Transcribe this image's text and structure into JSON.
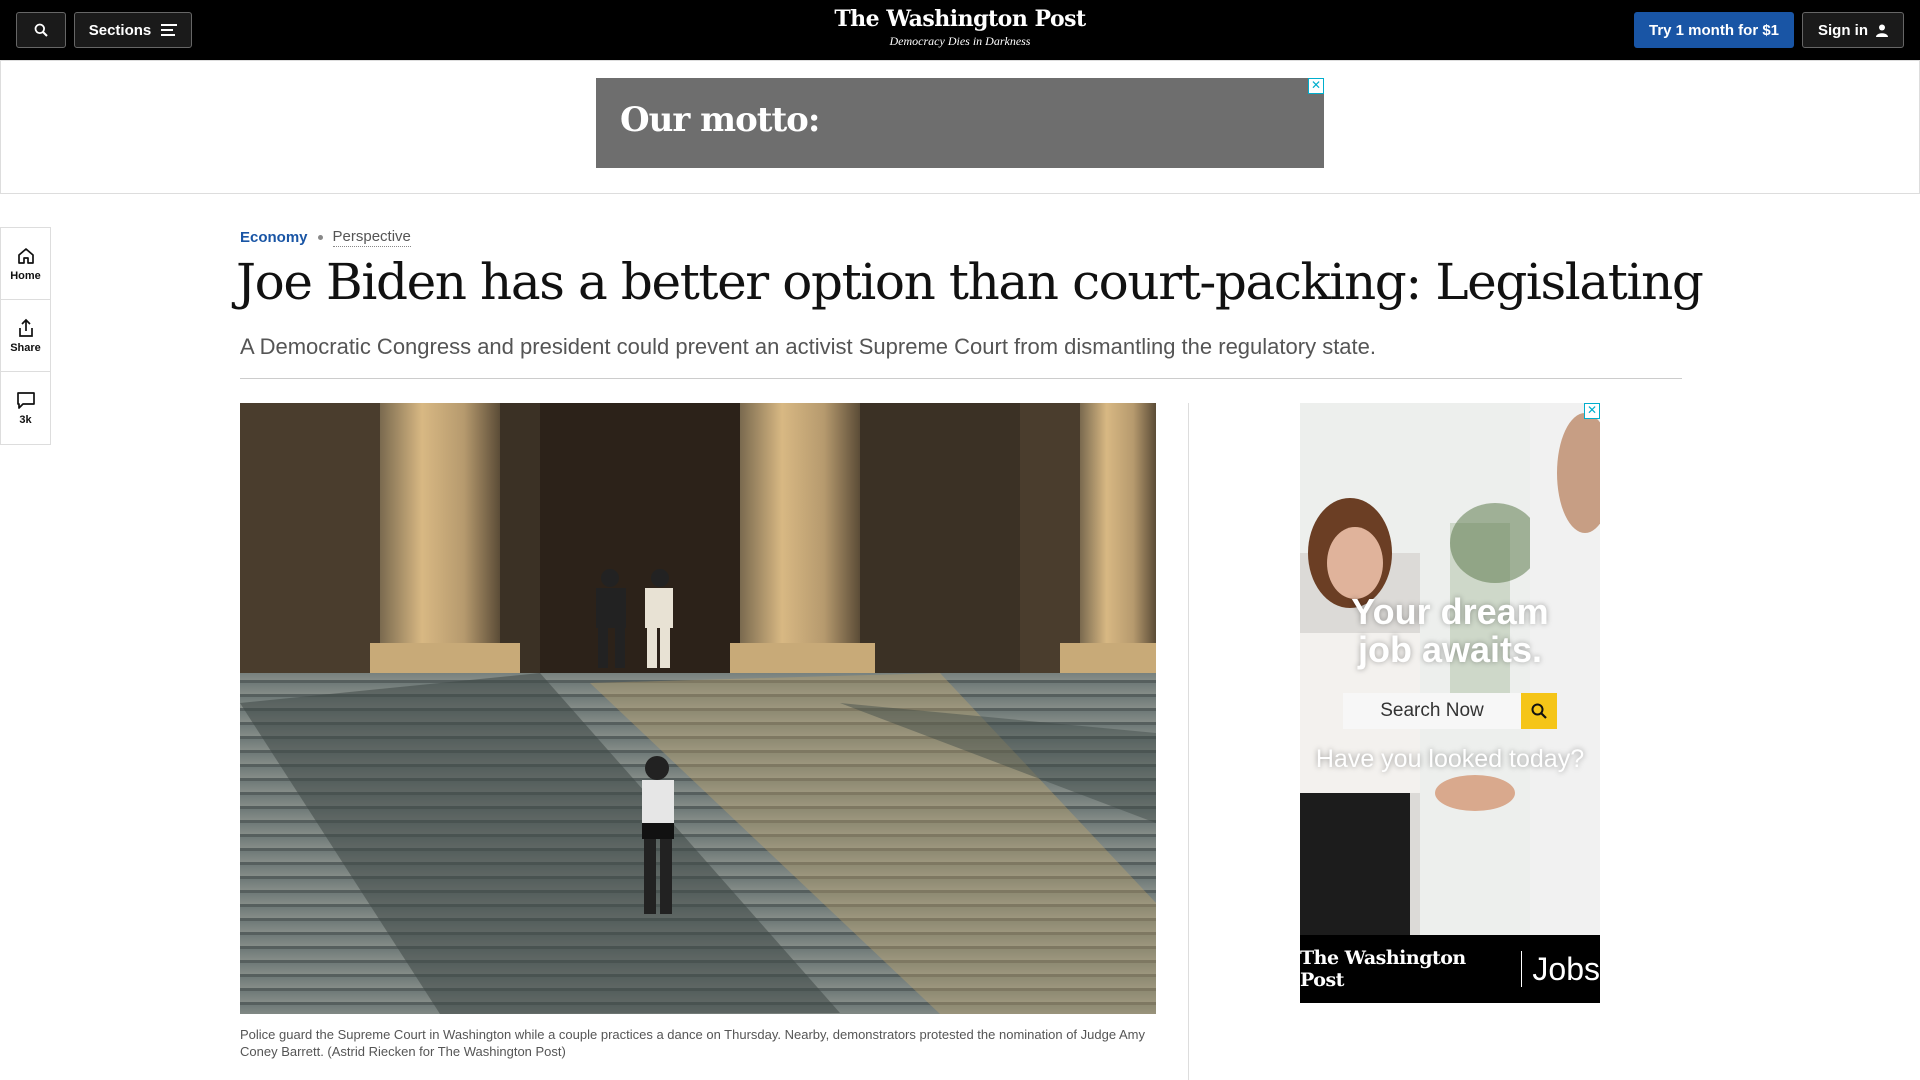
{
  "nav": {
    "search_icon": "search-icon",
    "sections_label": "Sections",
    "logo": "The Washington Post",
    "tagline": "Democracy Dies in Darkness",
    "subscribe_label": "Try 1 month for $1",
    "signin_label": "Sign in"
  },
  "top_ad": {
    "text": "Our motto:",
    "close": "✕"
  },
  "left_rail": {
    "items": [
      {
        "label": "Home",
        "icon": "home-icon"
      },
      {
        "label": "Share",
        "icon": "share-icon"
      },
      {
        "label": "3k",
        "icon": "comment-icon"
      }
    ]
  },
  "article": {
    "section": "Economy",
    "label": "Perspective",
    "headline": "Joe Biden has a better option than court-packing: Legislating",
    "dek": "A Democratic Congress and president could prevent an activist Supreme Court from dismantling the regulatory state.",
    "caption": "Police guard the Supreme Court in Washington while a couple practices a dance on Thursday. Nearby, demonstrators protested the nomination of Judge Amy Coney Barrett. (Astrid Riecken for The Washington Post)"
  },
  "side_ad": {
    "close": "✕",
    "headline_1": "Your dream",
    "headline_2": "job awaits.",
    "search_label": "Search Now",
    "subline": "Have you looked today?",
    "footer_logo": "The Washington Post",
    "footer_jobs": "Jobs"
  },
  "colors": {
    "nav_bg": "#000000",
    "accent_blue": "#1955a5",
    "ad_gray": "#6e6e6e",
    "ad_yellow": "#f5c518"
  }
}
